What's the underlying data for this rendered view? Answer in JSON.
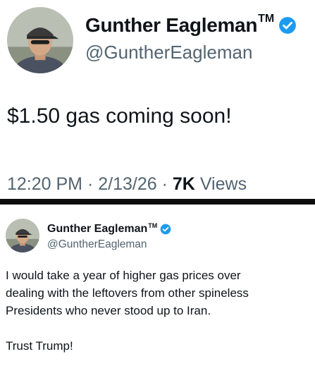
{
  "top_tweet": {
    "author": {
      "name": "Gunther Eagleman",
      "trademark": "TM",
      "handle": "@GuntherEagleman",
      "verified": true
    },
    "text": "$1.50 gas coming soon!",
    "meta": {
      "time": "12:20 PM",
      "separator": "·",
      "date": "2/13/26",
      "views_count": "7K",
      "views_label": "Views"
    }
  },
  "bottom_tweet": {
    "author": {
      "name": "Gunther Eagleman",
      "trademark": "TM",
      "handle": "@GuntherEagleman",
      "verified": true
    },
    "paragraphs": [
      "I would take a year of higher gas prices over\ndealing with the leftovers from other spineless\nPresidents who never stood up to Iran.",
      "Trust Trump!"
    ]
  },
  "colors": {
    "verified_badge": "#1d9bf0",
    "text_primary": "#0f1419",
    "text_secondary": "#536471",
    "divider": "#0d0d0d"
  },
  "icons": {
    "verified": "verified-badge-icon"
  }
}
